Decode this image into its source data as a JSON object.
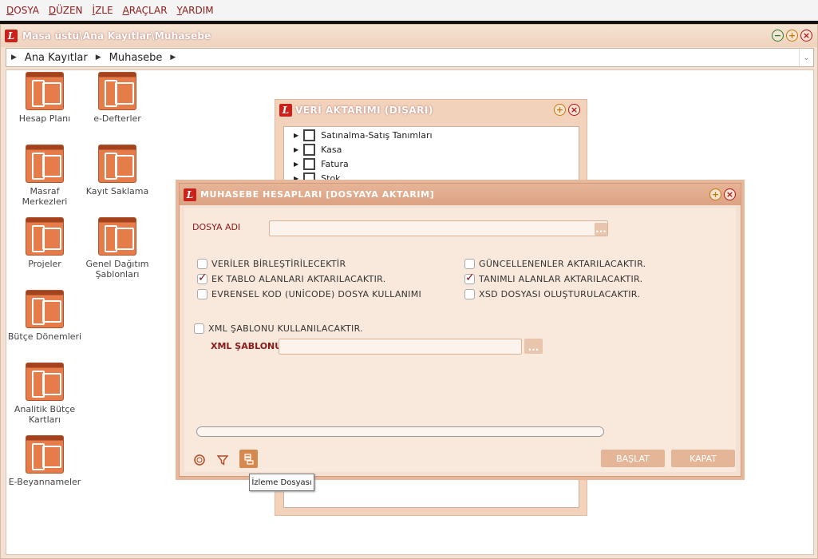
{
  "menu": {
    "items": [
      {
        "ul": "D",
        "rest": "OSYA"
      },
      {
        "ul": "D",
        "rest": "ÜZEN"
      },
      {
        "ul": "İ",
        "rest": "ZLE"
      },
      {
        "ul": "A",
        "rest": "RAÇLAR"
      },
      {
        "ul": "Y",
        "rest": "ARDIM"
      }
    ]
  },
  "main_window": {
    "logo": "L",
    "title": "Masa üstü\\Ana Kayıtlar\\Muhasebe",
    "breadcrumb": [
      "Ana Kayıtlar",
      "Muhasebe"
    ]
  },
  "desktop_icons": [
    {
      "label": "Hesap Planı"
    },
    {
      "label": "e-Defterler"
    },
    {
      "label": "Masraf Merkezleri"
    },
    {
      "label": "Kayıt Saklama"
    },
    {
      "label": "Projeler"
    },
    {
      "label": "Genel Dağıtım Şablonları"
    },
    {
      "label": "Bütçe Dönemleri"
    },
    {
      "label": "Analitik Bütçe Kartları"
    },
    {
      "label": "E-Beyannameler"
    }
  ],
  "export_window": {
    "logo": "L",
    "title": "VERİ AKTARIMI (DIŞARI)",
    "items": [
      "Satınalma-Satış Tanımları",
      "Kasa",
      "Fatura",
      "Stok"
    ]
  },
  "dialog": {
    "logo": "L",
    "title": "MUHASEBE HESAPLARI [DOSYAYA AKTARIM]",
    "file_name_label": "DOSYA ADI",
    "file_name_value": "",
    "options_left": [
      {
        "label": "VERİLER BİRLEŞTİRİLECEKTİR",
        "checked": false
      },
      {
        "label": "EK TABLO ALANLARI AKTARILACAKTIR.",
        "checked": true
      },
      {
        "label": "EVRENSEL KOD (UNİCODE) DOSYA KULLANIMI",
        "checked": false
      }
    ],
    "options_right": [
      {
        "label": "GÜNCELLENENLER AKTARILACAKTIR.",
        "checked": false
      },
      {
        "label": "TANIMLI ALANLAR AKTARILACAKTIR.",
        "checked": true
      },
      {
        "label": "XSD DOSYASI OLUŞTURULACAKTIR.",
        "checked": false
      }
    ],
    "xml_template_option": {
      "label": "XML ŞABLONU KULLANILACAKTIR.",
      "checked": false
    },
    "xml_template_label": "XML ŞABLONU",
    "xml_template_value": "",
    "browse_label": "...",
    "progress": 0,
    "start_button": "BAŞLAT",
    "close_button": "KAPAT",
    "tooltip": "İzleme Dosyası"
  }
}
